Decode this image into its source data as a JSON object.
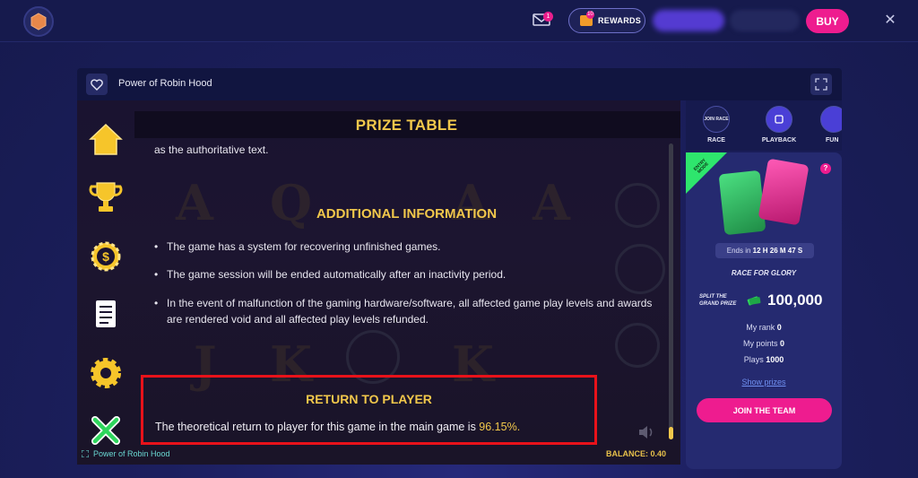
{
  "topbar": {
    "mail_badge": "1",
    "rewards_label": "REWARDS",
    "rewards_badge": "10",
    "buy_label": "BUY"
  },
  "game_header": {
    "title": "Power of Robin Hood"
  },
  "prize_table": {
    "title": "PRIZE TABLE",
    "auth_text": "as the authoritative text.",
    "additional_heading": "ADDITIONAL INFORMATION",
    "bullets": [
      "The game has a system for recovering unfinished games.",
      "The game session will be ended automatically after an inactivity period.",
      "In the event of malfunction of the gaming hardware/software, all affected game play levels and awards are rendered void and all affected play levels refunded."
    ],
    "rtp_heading": "RETURN TO PLAYER",
    "rtp_text": "The theoretical return to player for this game in the main game is",
    "rtp_value": "96.15%.",
    "scroll_position": 0.96
  },
  "game_footer": {
    "title": "Power of Robin Hood",
    "balance": "BALANCE: 0.40"
  },
  "side_icons": [
    "home-icon",
    "trophy-icon",
    "coin-settings-icon",
    "paytable-scroll-icon",
    "gear-icon",
    "close-x-icon"
  ],
  "right_panel": {
    "tabs": [
      {
        "circle_text": "JOIN RACE",
        "label": "RACE"
      },
      {
        "circle_text": "",
        "label": "PLAYBACK"
      },
      {
        "circle_text": "",
        "label": "FUN"
      }
    ],
    "entry_ribbon": "ENTRY MODE",
    "help": "?",
    "ends_prefix": "Ends in",
    "ends_time": "12 H 26 M 47 S",
    "race_name": "RACE FOR GLORY",
    "split_label_1": "SPLIT THE",
    "split_label_2": "GRAND PRIZE",
    "prize_amount": "100,000",
    "my_rank_label": "My rank",
    "my_rank_value": "0",
    "my_points_label": "My points",
    "my_points_value": "0",
    "plays_label": "Plays",
    "plays_value": "1000",
    "show_prizes": "Show prizes",
    "join_button": "JOIN THE TEAM"
  },
  "colors": {
    "accent_pink": "#ee1c8f",
    "gold": "#f2c84b",
    "highlight_red": "#e8121a"
  }
}
